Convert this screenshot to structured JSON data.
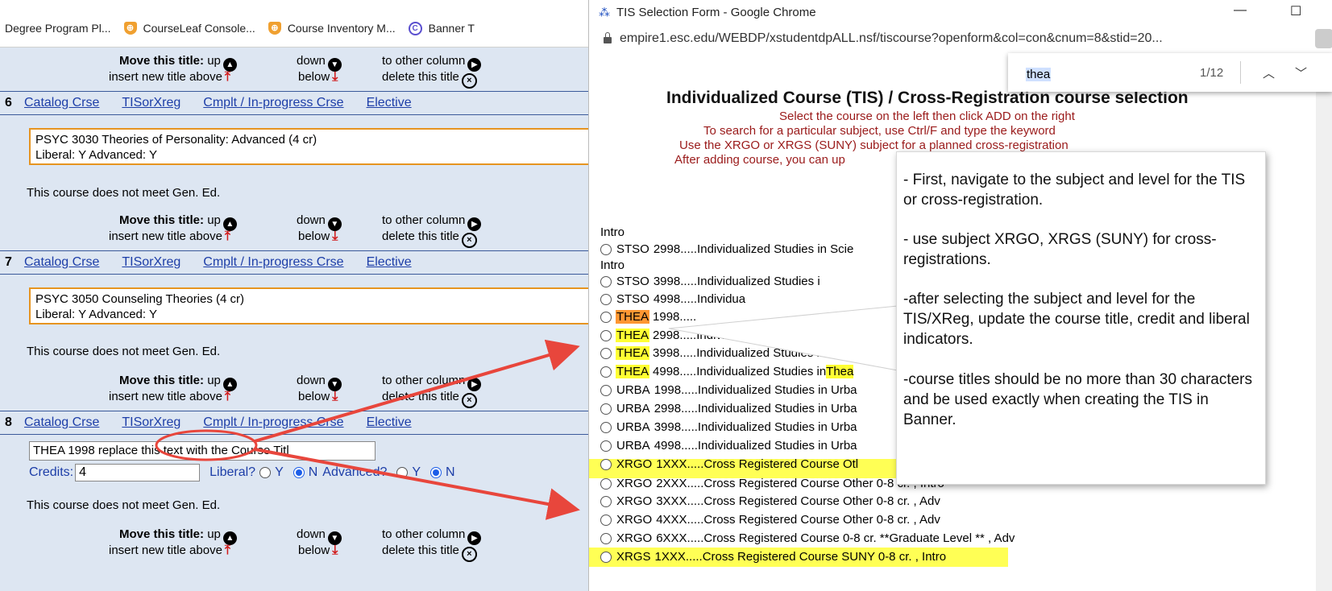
{
  "bookmarks": [
    {
      "label": "Degree Program Pl...",
      "icon": "none"
    },
    {
      "label": "CourseLeaf Console...",
      "icon": "shield-icon"
    },
    {
      "label": "Course Inventory M...",
      "icon": "shield-icon"
    },
    {
      "label": "Banner T",
      "icon": "banner-icon"
    }
  ],
  "controls": {
    "move_label": "Move this title:",
    "up": "up",
    "down": "down",
    "other_column": "to other column",
    "insert_above": "insert new title above",
    "below": "below",
    "delete": "delete this title"
  },
  "links": {
    "catalog": "Catalog Crse",
    "tis": "TISorXreg",
    "cmplt": "Cmplt / In-progress Crse",
    "elective": "Elective"
  },
  "entries": [
    {
      "num": "6",
      "line1": "PSYC 3030 Theories of Personality: Advanced (4 cr)",
      "line2": "Liberal: Y Advanced: Y"
    },
    {
      "num": "7",
      "line1": "PSYC 3050 Counseling Theories (4 cr)",
      "line2": "Liberal: Y Advanced: Y"
    },
    {
      "num": "8"
    }
  ],
  "gened_text": "This course does not meet Gen. Ed.",
  "entry8": {
    "title_value": "THEA 1998 replace this text with the Course Titl",
    "credits_label": "Credits:",
    "credits_value": "4",
    "liberal_label": "Liberal?",
    "advanced_label": "Advanced?",
    "y": "Y",
    "n": "N"
  },
  "window": {
    "title": "TIS Selection Form - Google Chrome",
    "url": "empire1.esc.edu/WEBDP/xstudentdpALL.nsf/tiscourse?openform&col=con&cnum=8&stid=20..."
  },
  "find": {
    "term": "thea",
    "count": "1/12"
  },
  "form": {
    "title": "Individualized Course (TIS) / Cross-Registration course selection",
    "instructions": [
      "Select the course on the left then click ADD on the right",
      "To search for a particular subject, use Ctrl/F and type the keyword",
      "Use the XRGO or XRGS (SUNY) subject for a planned cross-registration",
      "After adding course, you can up"
    ],
    "intro1": "Intro",
    "intro2": "Intro",
    "courses": [
      {
        "code": "STSO",
        "num": "2998",
        "desc": ".....Individualized Studies in Scie"
      },
      {
        "code": "STSO",
        "num": "3998",
        "desc": ".....Individualized Studies i"
      },
      {
        "code": "STSO",
        "num": "4998",
        "desc": ".....Individua"
      },
      {
        "code": "THEA",
        "num": "1998",
        "desc": "....."
      },
      {
        "code": "THEA",
        "num": "2998",
        "desc": ".....Individualiz"
      },
      {
        "code": "THEA",
        "num": "3998",
        "desc": ".....Individualized Studies in"
      },
      {
        "code": "THEA",
        "num": "4998",
        "desc": ".....Individualized Studies in ",
        "tail": "Thea"
      },
      {
        "code": "URBA",
        "num": "1998",
        "desc": ".....Individualized Studies in Urba"
      },
      {
        "code": "URBA",
        "num": "2998",
        "desc": ".....Individualized Studies in Urba"
      },
      {
        "code": "URBA",
        "num": "3998",
        "desc": ".....Individualized Studies in Urba"
      },
      {
        "code": "URBA",
        "num": "4998",
        "desc": ".....Individualized Studies in Urba"
      },
      {
        "code": "XRGO",
        "num": "1XXX",
        "desc": ".....Cross Registered Course Otl"
      },
      {
        "code": "XRGO",
        "num": "2XXX",
        "desc": ".....Cross Registered Course Other 0-8 cr. , Intro"
      },
      {
        "code": "XRGO",
        "num": "3XXX",
        "desc": ".....Cross Registered Course Other 0-8 cr. , Adv"
      },
      {
        "code": "XRGO",
        "num": "4XXX",
        "desc": ".....Cross Registered Course Other 0-8 cr. , Adv"
      },
      {
        "code": "XRGO",
        "num": "6XXX",
        "desc": ".....Cross Registered Course 0-8 cr. **Graduate Level ** , Adv"
      },
      {
        "code": "XRGS",
        "num": "1XXX",
        "desc": ".....Cross Registered Course SUNY 0-8 cr. , Intro"
      }
    ]
  },
  "callout": [
    "- First, navigate to the subject and level for the TIS or cross-registration.",
    "- use subject XRGO, XRGS (SUNY) for cross-registrations.",
    "-after selecting the subject and level for the TIS/XReg, update the course title, credit and liberal indicators.",
    "-course titles should be no more than 30 characters and be used exactly when creating the TIS in Banner."
  ],
  "colors": {
    "link": "#1d3ea8",
    "highlight": "#ffff33",
    "current_match": "#ff9632",
    "annotation": "#e8463c",
    "instruction": "#9a1a1a"
  }
}
